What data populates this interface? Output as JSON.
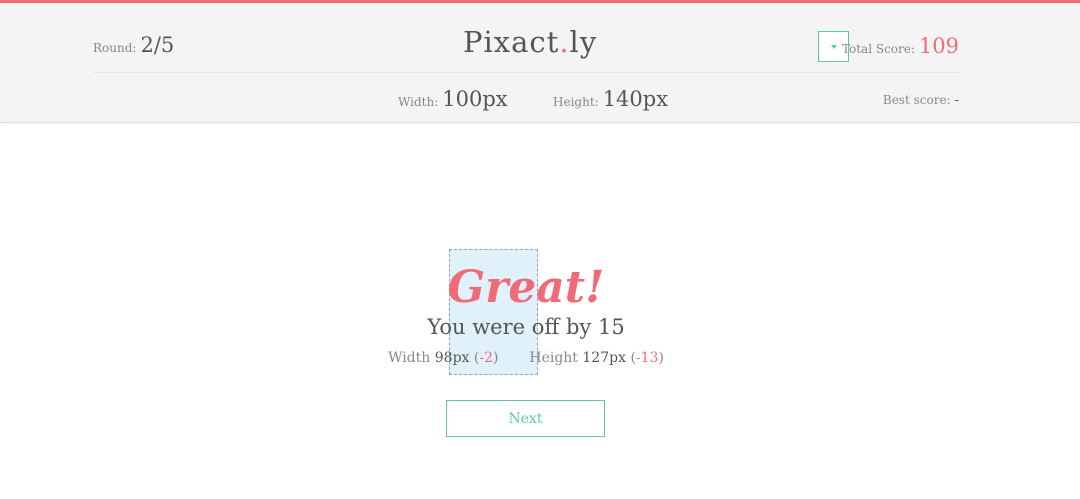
{
  "header": {
    "round_label": "Round:",
    "round_value": "2/5",
    "logo_part1": "Pixact",
    "logo_dot": ".",
    "logo_part2": "ly",
    "dropdown_icon": "chevron-down-icon",
    "total_score_label": "Total Score:",
    "total_score_value": "109",
    "target_width_label": "Width:",
    "target_width_value": "100px",
    "target_height_label": "Height:",
    "target_height_value": "140px",
    "best_score_label": "Best score:",
    "best_score_value": "-"
  },
  "result": {
    "title": "Great!",
    "off_by": "You were off by 15",
    "width_label": "Width",
    "width_value": "98px",
    "width_diff": "-2",
    "height_label": "Height",
    "height_value": "127px",
    "height_diff": "-13"
  },
  "actions": {
    "next_label": "Next"
  },
  "colors": {
    "accent_red": "#f06b78",
    "accent_green": "#5cc9a7",
    "header_bg": "#f4f4f4",
    "drawn_rect_fill": "#d6ecf8"
  }
}
